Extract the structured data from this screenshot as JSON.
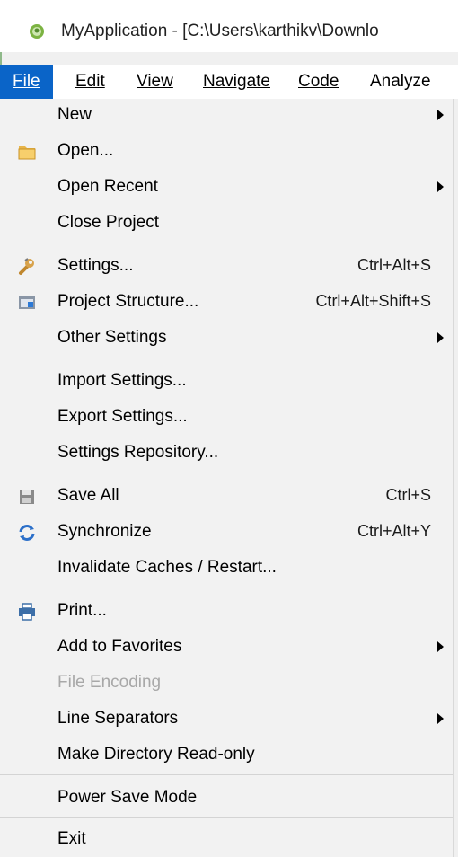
{
  "window": {
    "title": "MyApplication - [C:\\Users\\karthikv\\Downlo"
  },
  "menubar": {
    "items": [
      {
        "label": "File",
        "mnemonic": "F",
        "active": true
      },
      {
        "label": "Edit",
        "mnemonic": "E"
      },
      {
        "label": "View",
        "mnemonic": "V"
      },
      {
        "label": "Navigate",
        "mnemonic": "N"
      },
      {
        "label": "Code",
        "mnemonic": "C"
      },
      {
        "label": "Analyze",
        "mnemonic": "z"
      }
    ]
  },
  "file_menu": {
    "items": [
      {
        "label": "New",
        "submenu": true
      },
      {
        "label": "Open...",
        "icon": "folder-icon"
      },
      {
        "label": "Open Recent",
        "mnemonic": "R",
        "submenu": true
      },
      {
        "label": "Close Project"
      },
      {
        "label": "Settings...",
        "mnemonic": "t",
        "shortcut": "Ctrl+Alt+S",
        "icon": "wrench-icon"
      },
      {
        "label": "Project Structure...",
        "shortcut": "Ctrl+Alt+Shift+S",
        "icon": "project-structure-icon"
      },
      {
        "label": "Other Settings",
        "submenu": true
      },
      {
        "label": "Import Settings..."
      },
      {
        "label": "Export Settings...",
        "mnemonic": "E"
      },
      {
        "label": "Settings Repository..."
      },
      {
        "label": "Save All",
        "mnemonic": "S",
        "shortcut": "Ctrl+S",
        "icon": "save-icon"
      },
      {
        "label": "Synchronize",
        "mnemonic": "y",
        "shortcut": "Ctrl+Alt+Y",
        "icon": "synchronize-icon"
      },
      {
        "label": "Invalidate Caches / Restart..."
      },
      {
        "label": "Print...",
        "mnemonic": "P",
        "icon": "print-icon"
      },
      {
        "label": "Add to Favorites",
        "mnemonic": "a",
        "submenu": true
      },
      {
        "label": "File Encoding",
        "disabled": true
      },
      {
        "label": "Line Separators",
        "submenu": true
      },
      {
        "label": "Make Directory Read-only"
      },
      {
        "label": "Power Save Mode"
      },
      {
        "label": "Exit",
        "mnemonic": "x"
      }
    ]
  },
  "colors": {
    "menu_active_bg": "#0a64c8",
    "menu_bg": "#f2f2f2",
    "disabled_text": "#a8a8a8",
    "separator": "#d4d4d4"
  }
}
